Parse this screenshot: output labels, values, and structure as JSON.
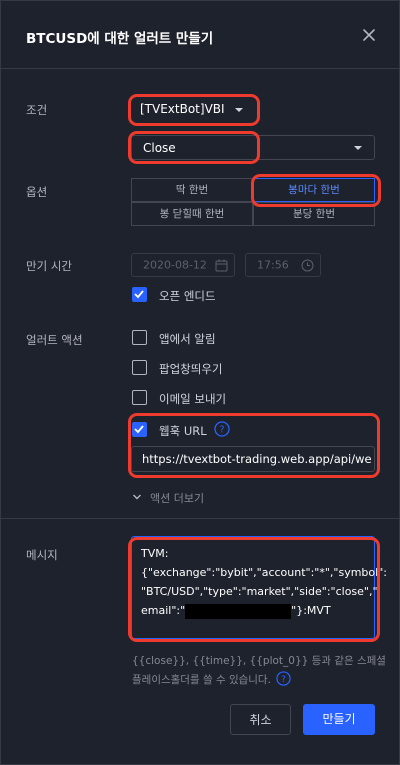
{
  "dialog": {
    "title": "BTCUSD에 대한 얼러트 만들기"
  },
  "condition": {
    "label": "조건",
    "source_value": "[TVExtBot]VBI",
    "trigger_value": "Close"
  },
  "options": {
    "label": "옵션",
    "buttons": [
      "딱 한번",
      "봉마다 한번",
      "봉 닫힐때 한번",
      "분당 한번"
    ],
    "selected": "봉마다 한번"
  },
  "expiration": {
    "label": "만기 시간",
    "date": "2020-08-12",
    "time": "17:56",
    "open_ended_label": "오픈 엔디드",
    "open_ended_checked": true
  },
  "alert_actions": {
    "label": "얼러트 액션",
    "items": [
      {
        "label": "앱에서 알림",
        "checked": false
      },
      {
        "label": "팝업창띄우기",
        "checked": false
      },
      {
        "label": "이메일 보내기",
        "checked": false
      },
      {
        "label": "웹훅 URL",
        "checked": true
      }
    ],
    "webhook_url": "https://tvextbot-trading.web.app/api/we",
    "more_actions_label": "액션 더보기"
  },
  "message": {
    "label": "메시지",
    "line1": "TVM:",
    "line2": "{\"exchange\":\"bybit\",\"account\":\"*\",\"symbol\":",
    "line3": "\"BTC/USD\",\"type\":\"market\",\"side\":\"close\",\"",
    "line4_prefix": "email\":\"",
    "line4_suffix": "\"}:MVT",
    "hint_line1": "{{close}}, {{time}}, {{plot_0}} 등과 같은 스페셜",
    "hint_line2": "플레이스홀더를 쓸 수 있습니다."
  },
  "footer": {
    "cancel_label": "취소",
    "create_label": "만들기"
  },
  "colors": {
    "accent": "#2962ff",
    "highlight": "#ef3b2d",
    "background": "#1e222d"
  }
}
